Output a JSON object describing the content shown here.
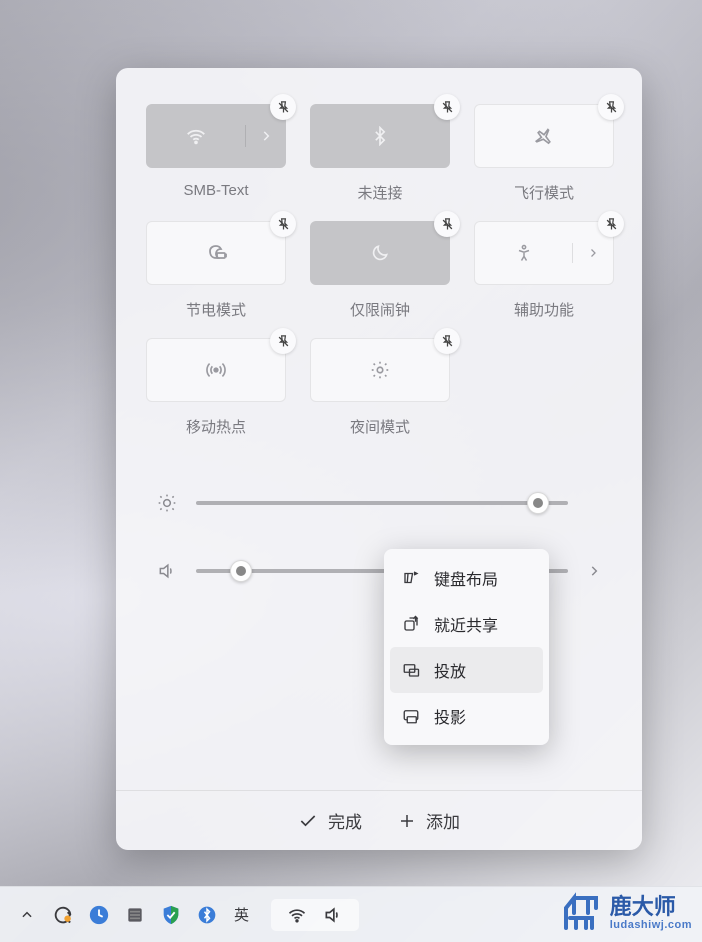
{
  "tiles": [
    {
      "label": "SMB-Text",
      "icon": "wifi",
      "style": "active",
      "split": true
    },
    {
      "label": "未连接",
      "icon": "bluetooth",
      "style": "active"
    },
    {
      "label": "飞行模式",
      "icon": "airplane",
      "style": "light"
    },
    {
      "label": "节电模式",
      "icon": "battery-saver",
      "style": "light"
    },
    {
      "label": "仅限闹钟",
      "icon": "moon",
      "style": "active"
    },
    {
      "label": "辅助功能",
      "icon": "accessibility",
      "style": "light",
      "split": true
    },
    {
      "label": "移动热点",
      "icon": "hotspot",
      "style": "light"
    },
    {
      "label": "夜间模式",
      "icon": "night-light",
      "style": "light"
    }
  ],
  "sliders": {
    "brightness": {
      "value": 92
    },
    "volume": {
      "value": 12
    }
  },
  "footer": {
    "done": "完成",
    "add": "添加"
  },
  "dropdown": {
    "items": [
      {
        "icon": "keyboard-layout",
        "label": "键盘布局"
      },
      {
        "icon": "nearby-share",
        "label": "就近共享"
      },
      {
        "icon": "cast",
        "label": "投放",
        "hover": true
      },
      {
        "icon": "project",
        "label": "投影"
      }
    ]
  },
  "taskbar": {
    "ime": "英"
  },
  "watermark": {
    "name": "鹿大师",
    "url": "ludashiwj.com"
  }
}
